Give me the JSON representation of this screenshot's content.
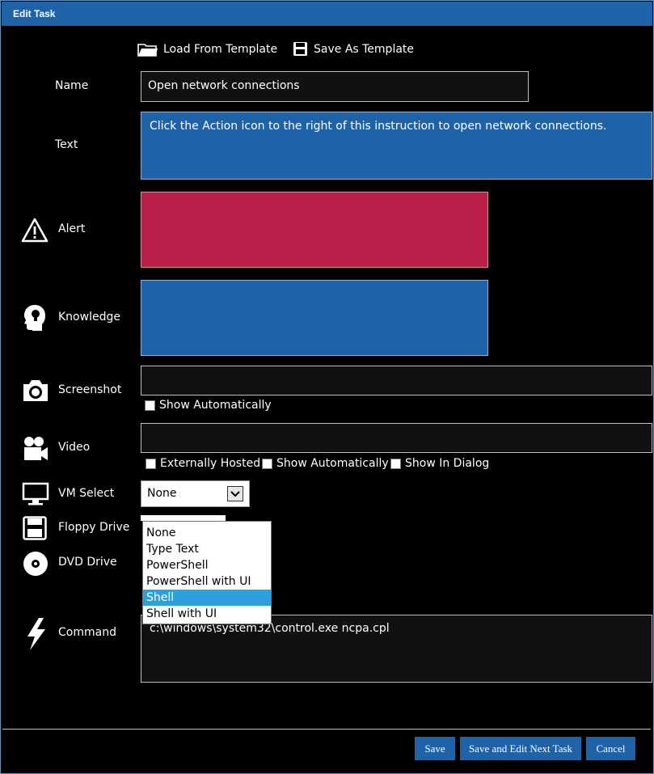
{
  "window": {
    "title": "Edit Task"
  },
  "toolbar": {
    "load_label": "Load From Template",
    "save_label": "Save As Template"
  },
  "form": {
    "name": {
      "label": "Name",
      "value": "Open network connections"
    },
    "text": {
      "label": "Text",
      "value": "Click the Action icon to the right of this instruction to open network connections."
    },
    "alert": {
      "label": "Alert",
      "value": "",
      "color": "#bb1e48"
    },
    "knowledge": {
      "label": "Knowledge",
      "value": "",
      "color": "#1e63a8"
    },
    "screenshot": {
      "label": "Screenshot",
      "value": "",
      "show_automatically": "Show Automatically"
    },
    "video": {
      "label": "Video",
      "value": "",
      "externally_hosted": "Externally Hosted",
      "show_automatically": "Show Automatically",
      "show_in_dialog": "Show In Dialog"
    },
    "vm_select": {
      "label": "VM Select",
      "value": "None"
    },
    "floppy": {
      "label": "Floppy Drive"
    },
    "dvd": {
      "label": "DVD Drive"
    },
    "command": {
      "label": "Command",
      "value": "c:\\windows\\system32\\control.exe ncpa.cpl"
    }
  },
  "dropdown": {
    "options": [
      "None",
      "Type Text",
      "PowerShell",
      "PowerShell with UI",
      "Shell",
      "Shell with UI"
    ],
    "selected": "Shell"
  },
  "footer": {
    "save": "Save",
    "save_next": "Save and Edit Next Task",
    "cancel": "Cancel"
  },
  "colors": {
    "accent": "#1e63a8",
    "alert": "#bb1e48",
    "highlight": "#2aa0dc"
  }
}
